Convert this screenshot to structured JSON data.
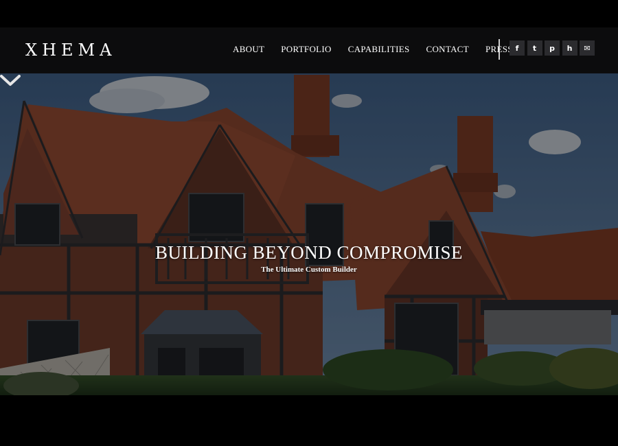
{
  "brand": {
    "logo_text": "XHEMA"
  },
  "nav": {
    "items": [
      {
        "label": "ABOUT"
      },
      {
        "label": "PORTFOLIO"
      },
      {
        "label": "CAPABILITIES"
      },
      {
        "label": "CONTACT"
      },
      {
        "label": "PRESS"
      }
    ]
  },
  "social": [
    {
      "icon": "facebook-icon",
      "glyph": "f"
    },
    {
      "icon": "twitter-icon",
      "glyph": "t"
    },
    {
      "icon": "pinterest-icon",
      "glyph": "p"
    },
    {
      "icon": "houzz-icon",
      "glyph": "h"
    },
    {
      "icon": "email-icon",
      "glyph": "✉"
    }
  ],
  "hero": {
    "title": "BUILDING BEYOND COMPROMISE",
    "subtitle": "The Ultimate Custom Builder",
    "scroll_icon": "chevron-down-icon"
  },
  "colors": {
    "header_bg": "#0c0c0d",
    "page_bg": "#000000",
    "text": "#ffffff",
    "social_bg": "#2b2b2e"
  }
}
